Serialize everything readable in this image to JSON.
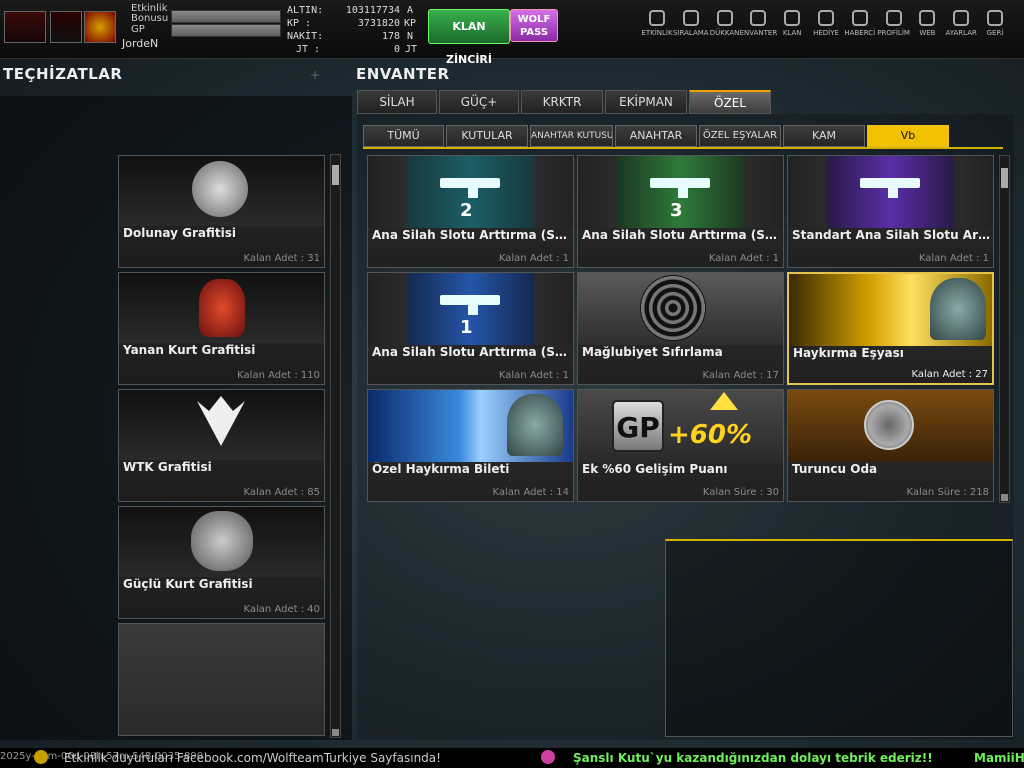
{
  "topbar": {
    "event_bonus_label": "Etkinlik Bonusu",
    "gp_label": "GP",
    "username": "JordeN",
    "stats": [
      {
        "label": "ALTIN:",
        "value": "103117734",
        "unit": "A"
      },
      {
        "label": "KP :",
        "value": "3731820",
        "unit": "KP"
      },
      {
        "label": "NAKİT:",
        "value": "178",
        "unit": "N"
      },
      {
        "label": "JT :",
        "value": "0",
        "unit": "JT"
      }
    ],
    "klan_zinciri": "KLAN ZİNCİRİ",
    "wolf_pass": "WOLF PASS",
    "nav": [
      {
        "label": "ETKİNLİK",
        "icon": "timer-icon"
      },
      {
        "label": "SIRALAMA",
        "icon": "medal-icon"
      },
      {
        "label": "DÜKKAN",
        "icon": "cart-icon"
      },
      {
        "label": "ENVANTER",
        "icon": "inventory-icon"
      },
      {
        "label": "KLAN",
        "icon": "shield-icon"
      },
      {
        "label": "HEDİYE",
        "icon": "gift-icon"
      },
      {
        "label": "HABERCİ",
        "icon": "megaphone-icon"
      },
      {
        "label": "PROFİLİM",
        "icon": "profile-icon"
      },
      {
        "label": "WEB",
        "icon": "globe-icon"
      },
      {
        "label": "AYARLAR",
        "icon": "gear-icon"
      },
      {
        "label": "GERİ",
        "icon": "back-icon"
      }
    ]
  },
  "left": {
    "title": "TEÇHİZATLAR",
    "items": [
      {
        "name": "Dolunay Grafitisi",
        "count": "Kalan Adet : 31"
      },
      {
        "name": "Yanan Kurt Grafitisi",
        "count": "Kalan Adet : 110"
      },
      {
        "name": "WTK Grafitisi",
        "count": "Kalan Adet : 85"
      },
      {
        "name": "Güçlü Kurt Grafitisi",
        "count": "Kalan Adet : 40"
      },
      {
        "name": "",
        "count": ""
      }
    ]
  },
  "inventory": {
    "title": "ENVANTER",
    "tabs": [
      "SİLAH",
      "GÜÇ+",
      "KRKTR",
      "EKİPMAN",
      "ÖZEL"
    ],
    "subtabs": [
      "TÜMÜ",
      "KUTULAR",
      "ANAHTAR KUTUSU",
      "ANAHTAR",
      "ÖZEL EŞYALAR",
      "KAM",
      "Vb"
    ],
    "items": [
      {
        "name": "Ana Silah Slotu Arttırma (Sil...",
        "count": "Kalan Adet : 1",
        "num": "2"
      },
      {
        "name": "Ana Silah Slotu Arttırma (Sil...",
        "count": "Kalan Adet : 1",
        "num": "3"
      },
      {
        "name": "Standart Ana Silah Slotu Artt...",
        "count": "Kalan Adet : 1",
        "num": ""
      },
      {
        "name": "Ana Silah Slotu Arttırma (Sil...",
        "count": "Kalan Adet : 1",
        "num": "1"
      },
      {
        "name": "Mağlubiyet  Sıfırlama",
        "count": "Kalan Adet : 17",
        "num": ""
      },
      {
        "name": "Haykırma Eşyası",
        "count": "Kalan Adet : 27",
        "num": ""
      },
      {
        "name": "Özel Haykırma Bileti",
        "count": "Kalan Adet : 14",
        "num": ""
      },
      {
        "name": "Ek %60 Gelişim Puanı",
        "count": "Kalan Süre : 30",
        "num": ""
      },
      {
        "name": "Turuncu Oda",
        "count": "Kalan Süre : 218",
        "num": ""
      }
    ],
    "gp_logo": "GP",
    "gp_bonus": "+60%"
  },
  "bottom": {
    "timestamp": "2025y-12m-06d-08h-57m-548-0035-890",
    "ticker1": "Etkinlik duyuruları Facebook.com/WolfteamTurkiye Sayfasında!",
    "ticker2": "Şanslı Kutu`yu kazandığınızdan dolayı tebrik ederiz!!",
    "ticker3": "MamiiH"
  },
  "colors": {
    "accent": "#f2c200",
    "green_btn": "#2a8a3a",
    "pass_btn": "#b84ad0"
  }
}
